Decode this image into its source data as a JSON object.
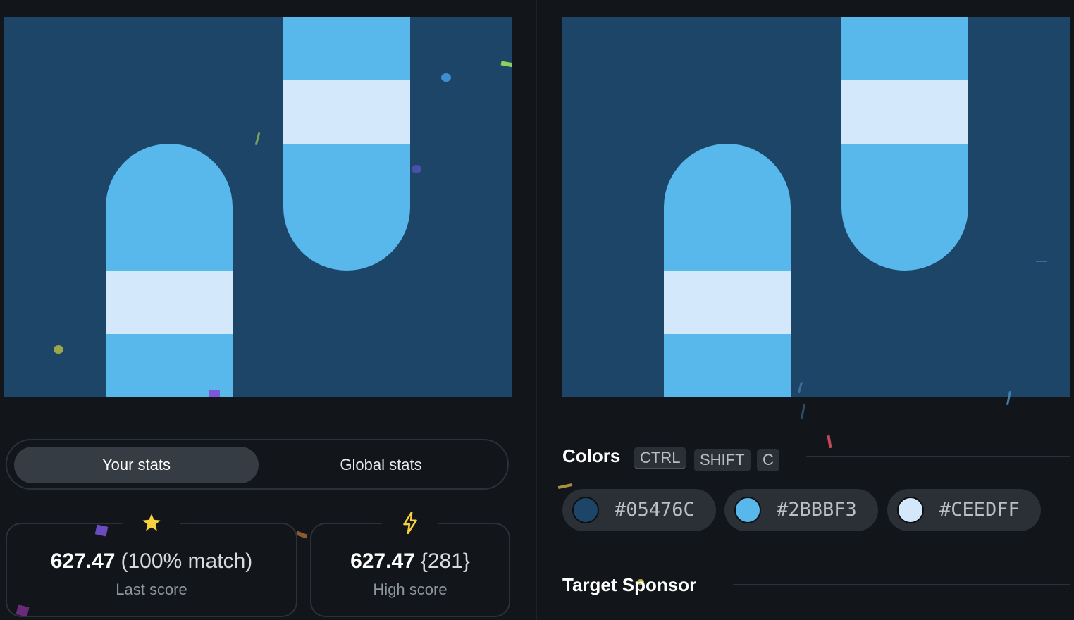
{
  "stats_tabs": {
    "your_stats": "Your stats",
    "global_stats": "Global stats",
    "active": "Your stats"
  },
  "last_score": {
    "icon": "star-icon",
    "value": "627.47",
    "extra": "(100% match)",
    "label": "Last score"
  },
  "high_score": {
    "icon": "lightning-icon",
    "value": "627.47",
    "extra": "{281}",
    "label": "High score"
  },
  "colors": {
    "title": "Colors",
    "shortcut_keys": [
      "CTRL",
      "SHIFT",
      "C"
    ],
    "swatches": [
      {
        "code": "#05476C",
        "hex": "#1d4568"
      },
      {
        "code": "#2BBBF3",
        "hex": "#58b7eb"
      },
      {
        "code": "#CEEDFF",
        "hex": "#d3e9fb"
      }
    ]
  },
  "sponsor": {
    "title": "Target Sponsor"
  },
  "palette": {
    "background": "#121519",
    "canvas_bg": "#1d4568",
    "shape": "#58b7eb",
    "band": "#d3e9fb",
    "star": "#f7d23e",
    "bolt": "#f7d23e"
  }
}
